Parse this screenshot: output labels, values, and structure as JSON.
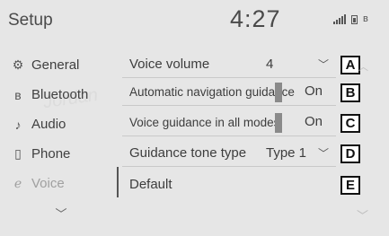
{
  "header": {
    "title": "Setup",
    "clock": "4:27"
  },
  "icons": {
    "signal": "signal-bars-icon",
    "battery": "battery-icon",
    "bluetooth_status": "bluetooth-icon"
  },
  "sidebar": {
    "items": [
      {
        "label": "General",
        "icon": "gear-icon",
        "glyph": "⚙",
        "active": false
      },
      {
        "label": "Bluetooth",
        "icon": "bluetooth-icon",
        "glyph": "ʙ",
        "active": false
      },
      {
        "label": "Audio",
        "icon": "music-note-icon",
        "glyph": "♪",
        "active": false
      },
      {
        "label": "Phone",
        "icon": "phone-icon",
        "glyph": "▯",
        "active": false
      },
      {
        "label": "Voice",
        "icon": "voice-icon",
        "glyph": "ℯ",
        "active": true
      }
    ],
    "scroll_glyph": "﹀"
  },
  "list": {
    "rows": [
      {
        "label": "Voice volume",
        "value": "4",
        "callout": "A"
      },
      {
        "label": "Automatic navigation guidance",
        "value": "On",
        "callout": "B"
      },
      {
        "label": "Voice guidance in all modes",
        "value": "On",
        "callout": "C"
      },
      {
        "label": "Guidance tone type",
        "value": "Type 1",
        "callout": "D"
      },
      {
        "label": "Default",
        "callout": "E"
      }
    ],
    "chevron": "﹀",
    "scroll_up": "︿",
    "scroll_down": "﹀"
  },
  "colors": {
    "background": "#e6e6e6",
    "text": "#3d3d3d",
    "inactive": "#a0a0a0"
  }
}
